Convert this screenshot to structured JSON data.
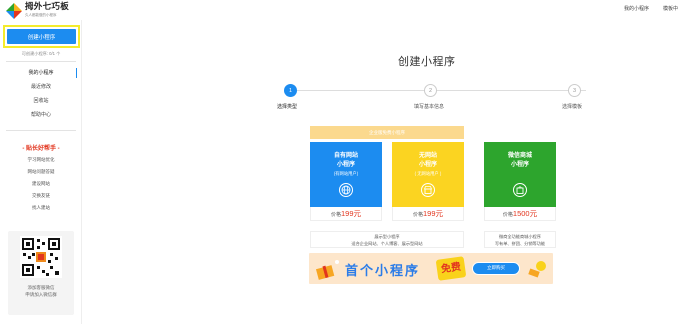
{
  "header": {
    "logo_title": "拇外七巧板",
    "logo_subtitle": "久人都能做的小程序",
    "links": [
      "我的小程序",
      "模板中"
    ]
  },
  "sidebar": {
    "create_button": "创建小程序",
    "can_create_text": "可创建小程序: 0/1 个",
    "nav_items": [
      {
        "label": "我的小程序",
        "active": true
      },
      {
        "label": "最近修改",
        "active": false
      },
      {
        "label": "回收站",
        "active": false
      },
      {
        "label": "帮助中心",
        "active": false
      }
    ],
    "help_title": "- 贴长好帮手 -",
    "help_items": [
      "学习网站优化",
      "网站问题答疑",
      "建设网站",
      "交换友链",
      "找人建站"
    ],
    "qr_caption_line1": "添加客服微信",
    "qr_caption_line2": "申请加入微信群"
  },
  "main": {
    "title": "创建小程序",
    "steps": [
      {
        "number": "1",
        "label": "选择类型",
        "active": true
      },
      {
        "number": "2",
        "label": "填写基本信息",
        "active": false
      },
      {
        "number": "3",
        "label": "选择模板",
        "active": false
      }
    ],
    "banner_text": "企业版免费小程序",
    "cards": [
      {
        "line1": "自有网站",
        "line2": "小程序",
        "sub": "(有网站用户)",
        "price_label": "价格",
        "price": "199元",
        "color": "#1c8cf0"
      },
      {
        "line1": "无网站",
        "line2": "小程序",
        "sub": "( 无网站用户 )",
        "price_label": "价格",
        "price": "199元",
        "color": "#fbd421"
      },
      {
        "line1": "微信商城",
        "line2": "小程序",
        "sub": "",
        "price_label": "价格",
        "price": "1500元",
        "color": "#2da52d"
      }
    ],
    "desc_left_line1": "展示型小程序",
    "desc_left_line2": "适合企业网站、个人博客、展示型网站",
    "desc_right_line1": "微商全功能商城小程序",
    "desc_right_line2": "写有单、拼团、分销等功能",
    "promo_text": "首个小程序",
    "promo_free": "免费",
    "promo_button": "立即购买"
  }
}
